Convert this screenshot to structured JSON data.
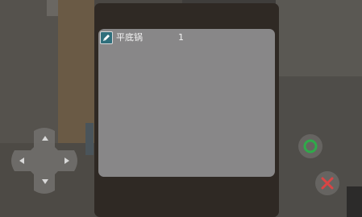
{
  "inventory": {
    "items": [
      {
        "name": "平底锅",
        "quantity": "1",
        "icon": "pencil-icon"
      }
    ]
  },
  "controls": {
    "dpad_icon": "dpad-icon",
    "confirm_icon": "circle-icon",
    "cancel_icon": "x-icon",
    "confirm_color": "#2faa4a",
    "cancel_color": "#d94545"
  }
}
